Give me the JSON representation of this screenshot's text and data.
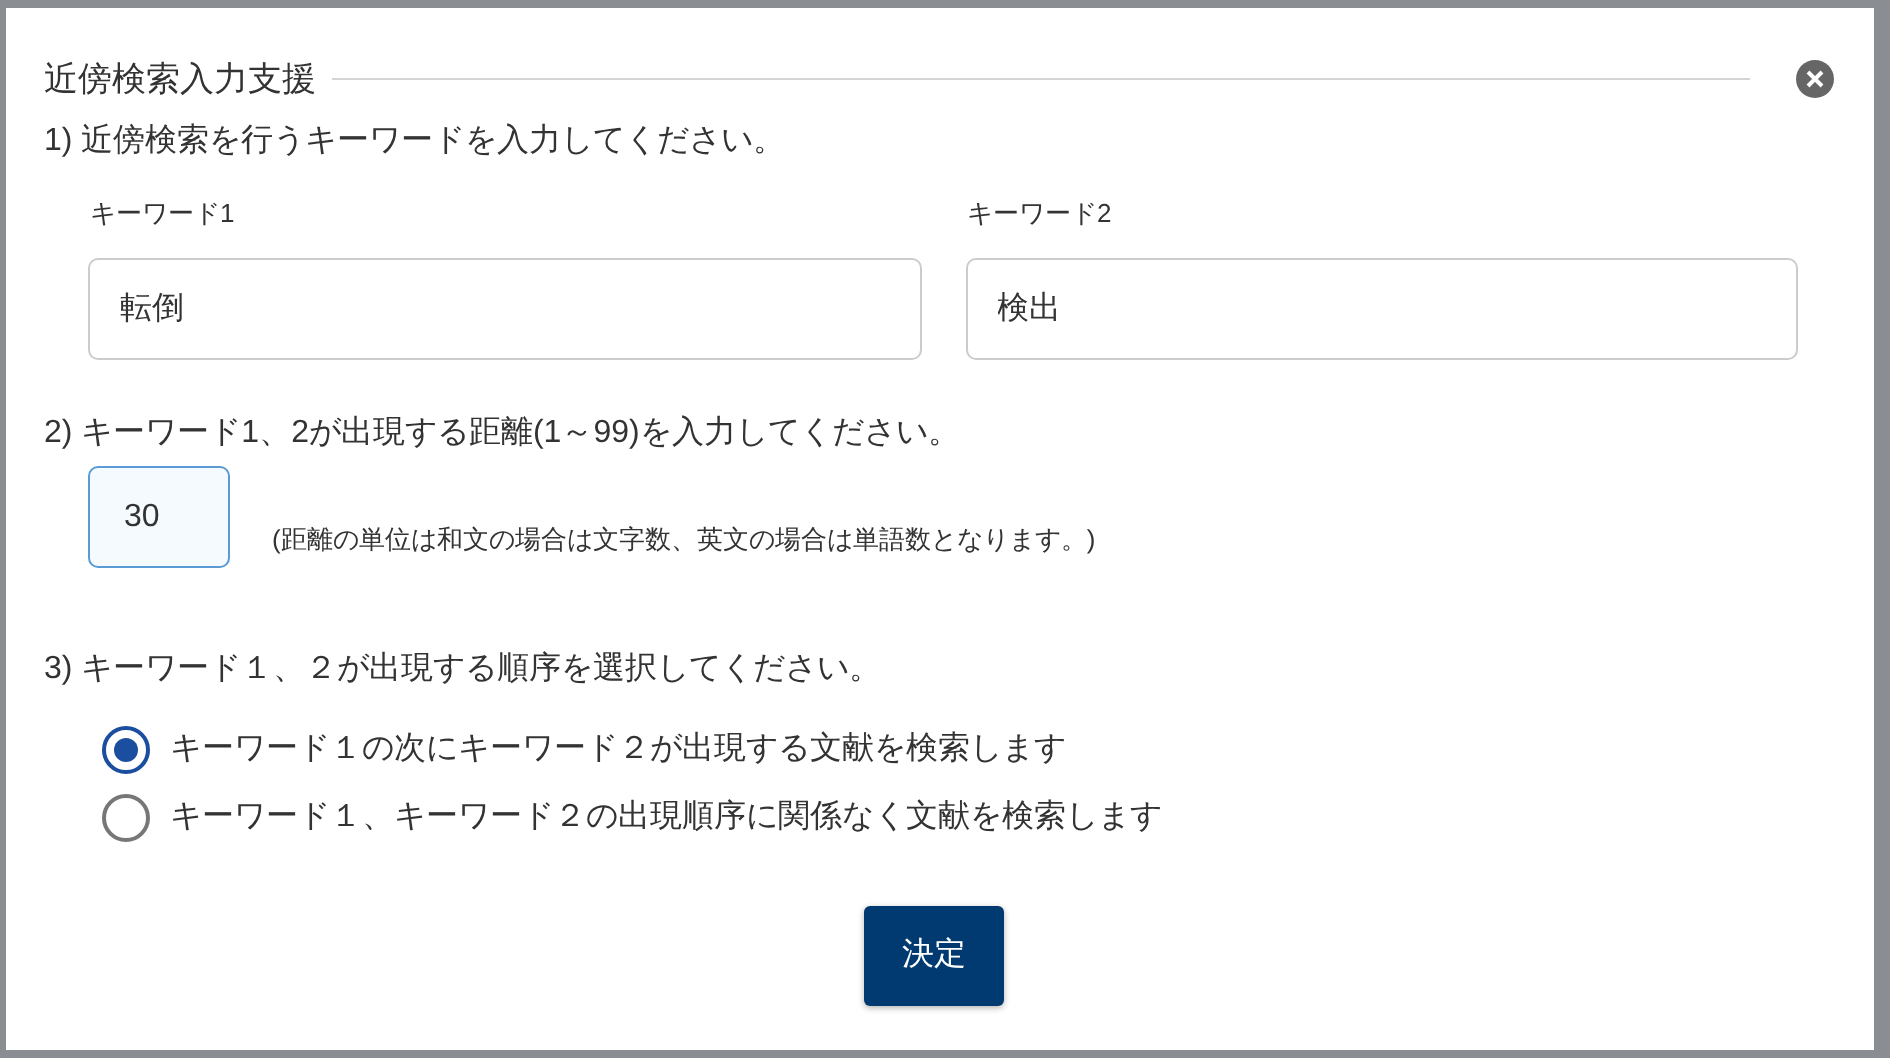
{
  "dialog": {
    "title": "近傍検索入力支援",
    "step1": {
      "label": "1) 近傍検索を行うキーワードを入力してください。",
      "fields": [
        {
          "label": "キーワード1",
          "value": "転倒"
        },
        {
          "label": "キーワード2",
          "value": "検出"
        }
      ]
    },
    "step2": {
      "label": "2) キーワード1、2が出現する距離(1～99)を入力してください。",
      "value": "30",
      "note": "(距離の単位は和文の場合は文字数、英文の場合は単語数となります。)"
    },
    "step3": {
      "label": "3) キーワード１、２が出現する順序を選択してください。",
      "options": [
        {
          "label": "キーワード１の次にキーワード２が出現する文献を検索します",
          "selected": true
        },
        {
          "label": "キーワード１、キーワード２の出現順序に関係なく文献を検索します",
          "selected": false
        }
      ]
    },
    "submit": "決定"
  }
}
